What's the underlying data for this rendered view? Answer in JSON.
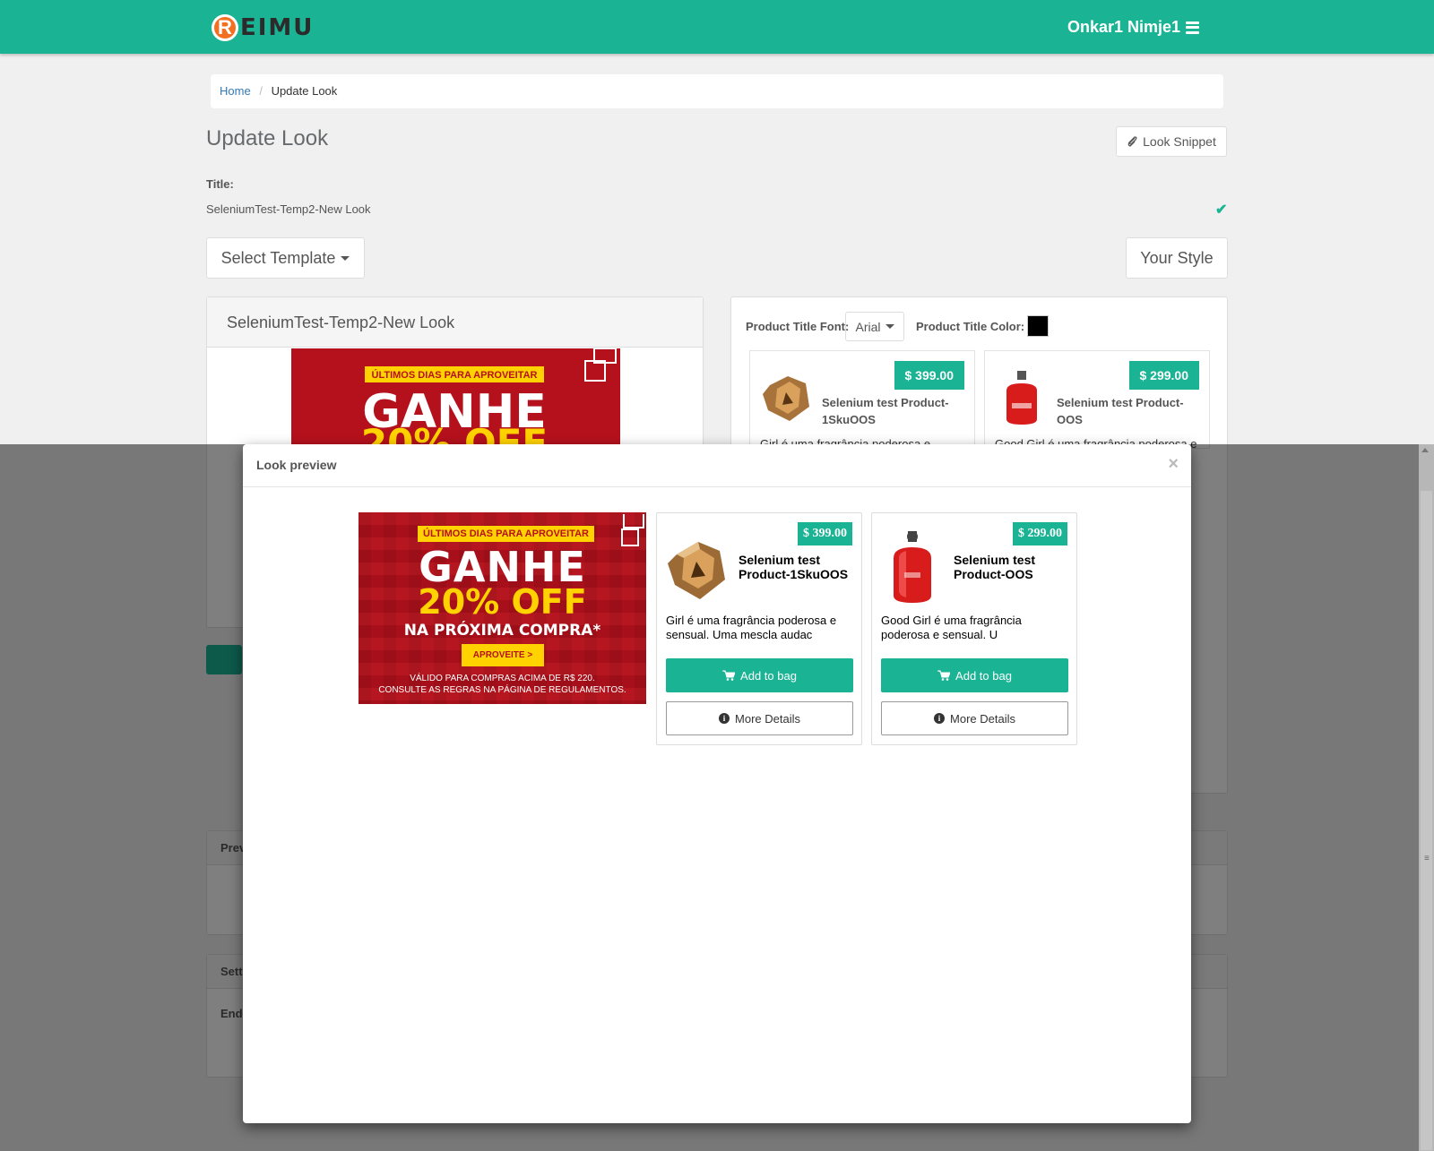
{
  "header": {
    "logo_letter": "R",
    "logo_text": "EIMU",
    "user_name": "Onkar1 Nimje1"
  },
  "breadcrumb": {
    "home": "Home",
    "separator": "/",
    "current": "Update Look"
  },
  "page": {
    "title": "Update Look",
    "snippet_button": "Look Snippet",
    "title_label": "Title:",
    "title_value": "SeleniumTest-Temp2-New Look",
    "select_template": "Select Template",
    "your_style": "Your Style"
  },
  "left_card": {
    "heading": "SeleniumTest-Temp2-New Look"
  },
  "style_panel": {
    "font_label": "Product Title Font:",
    "font_value": "Arial",
    "color_label": "Product Title Color:",
    "title_color": "#000000",
    "products": [
      {
        "price": "$ 399.00",
        "title_line1": "Selenium test Product-",
        "title_line2": "1SkuOOS",
        "desc": "Girl é uma fragrância poderosa e"
      },
      {
        "price": "$ 299.00",
        "title_line1": "Selenium test Product-OOS",
        "title_line2": "",
        "desc": "Good Girl é uma fragrância poderosa e"
      }
    ]
  },
  "background_panels": {
    "preview_label": "Prev",
    "settings_label": "Sett",
    "endpoint_label": "Endp"
  },
  "modal": {
    "title": "Look preview",
    "close": "×",
    "banner": {
      "tag": "ÚLTIMOS DIAS PARA APROVEITAR",
      "line1": "GANHE",
      "line2": "20% OFF",
      "line3": "NA PRÓXIMA COMPRA*",
      "button": "APROVEITE >",
      "small1": "VÁLIDO PARA COMPRAS ACIMA DE R$ 220.",
      "small2": "CONSULTE AS REGRAS NA PÁGINA DE REGULAMENTOS."
    },
    "products": [
      {
        "price": "$ 399.00",
        "title": "Selenium test Product-1SkuOOS",
        "desc": "Girl é uma fragrância poderosa e sensual. Uma mescla audac",
        "add_to_bag": "Add to bag",
        "more_details": "More Details"
      },
      {
        "price": "$ 299.00",
        "title": "Selenium test Product-OOS",
        "desc": "Good Girl é uma fragrância poderosa e sensual. U",
        "add_to_bag": "Add to bag",
        "more_details": "More Details"
      }
    ]
  },
  "colors": {
    "accent": "#1ab394",
    "banner_red": "#b5111c",
    "banner_yellow": "#ffd200"
  }
}
